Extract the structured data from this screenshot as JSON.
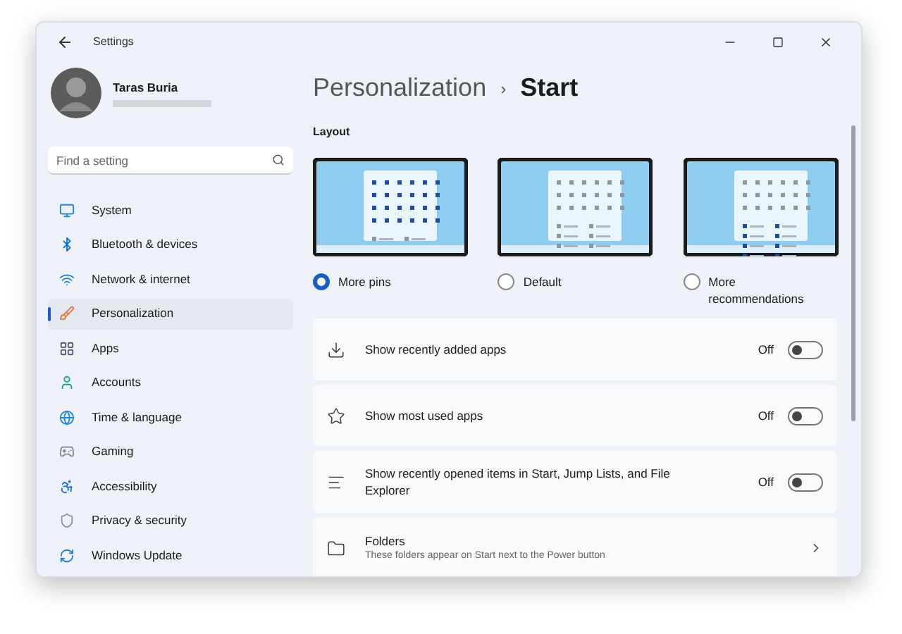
{
  "window": {
    "title": "Settings"
  },
  "user": {
    "name": "Taras Buria"
  },
  "search": {
    "placeholder": "Find a setting"
  },
  "sidebar": {
    "items": [
      {
        "label": "System",
        "selected": false
      },
      {
        "label": "Bluetooth & devices",
        "selected": false
      },
      {
        "label": "Network & internet",
        "selected": false
      },
      {
        "label": "Personalization",
        "selected": true
      },
      {
        "label": "Apps",
        "selected": false
      },
      {
        "label": "Accounts",
        "selected": false
      },
      {
        "label": "Time & language",
        "selected": false
      },
      {
        "label": "Gaming",
        "selected": false
      },
      {
        "label": "Accessibility",
        "selected": false
      },
      {
        "label": "Privacy & security",
        "selected": false
      },
      {
        "label": "Windows Update",
        "selected": false
      }
    ]
  },
  "breadcrumb": {
    "parent": "Personalization",
    "separator": "›",
    "current": "Start"
  },
  "layout_section": {
    "heading": "Layout",
    "options": [
      {
        "label": "More pins",
        "selected": true
      },
      {
        "label": "Default",
        "selected": false
      },
      {
        "label": "More recommendations",
        "selected": false
      }
    ]
  },
  "settings": [
    {
      "kind": "toggle",
      "label": "Show recently added apps",
      "state_label": "Off",
      "on": false
    },
    {
      "kind": "toggle",
      "label": "Show most used apps",
      "state_label": "Off",
      "on": false
    },
    {
      "kind": "toggle",
      "label": "Show recently opened items in Start, Jump Lists, and File Explorer",
      "state_label": "Off",
      "on": false
    },
    {
      "kind": "link",
      "label": "Folders",
      "description": "These folders appear on Start next to the Power button"
    }
  ]
}
